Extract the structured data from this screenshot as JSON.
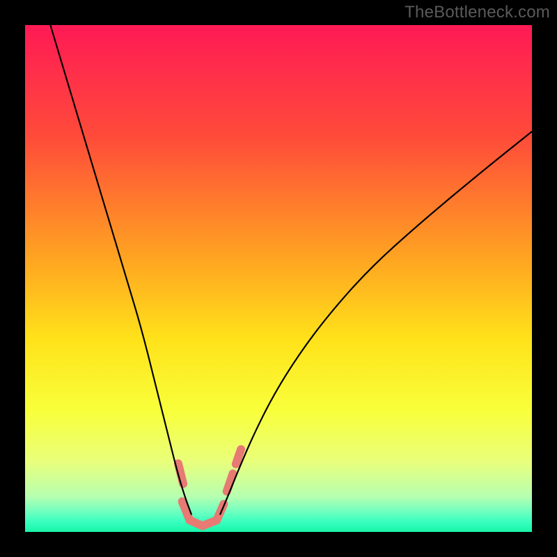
{
  "watermark": "TheBottleneck.com",
  "chart_data": {
    "type": "line",
    "title": "",
    "xlabel": "",
    "ylabel": "",
    "xlim": [
      0,
      100
    ],
    "ylim": [
      0,
      100
    ],
    "gradient_stops": [
      {
        "offset": 0,
        "color": "#ff1a55"
      },
      {
        "offset": 22,
        "color": "#ff4b3a"
      },
      {
        "offset": 45,
        "color": "#ffa022"
      },
      {
        "offset": 62,
        "color": "#ffe21a"
      },
      {
        "offset": 76,
        "color": "#f8ff3a"
      },
      {
        "offset": 86,
        "color": "#eaff7a"
      },
      {
        "offset": 93,
        "color": "#b7ffb0"
      },
      {
        "offset": 96,
        "color": "#6fffc0"
      },
      {
        "offset": 98,
        "color": "#38ffbf"
      },
      {
        "offset": 100,
        "color": "#18f5a8"
      }
    ],
    "series": [
      {
        "name": "left-arm",
        "x": [
          5,
          8,
          11,
          14,
          17,
          20,
          23,
          26,
          28,
          30,
          31.5,
          32.8
        ],
        "y": [
          100,
          90,
          80,
          70,
          60,
          50,
          40,
          28,
          20,
          12,
          7,
          3.5
        ]
      },
      {
        "name": "right-arm",
        "x": [
          38.5,
          40,
          42,
          45,
          49,
          54,
          60,
          68,
          78,
          90,
          100
        ],
        "y": [
          3.5,
          7,
          12,
          19,
          27,
          35,
          43,
          52,
          61,
          71,
          79
        ]
      }
    ],
    "highlight_band": {
      "color": "#e77a73",
      "width": 12,
      "segments": [
        [
          [
            30.2,
            13.5
          ],
          [
            31.2,
            9.5
          ]
        ],
        [
          [
            31.0,
            6.0
          ],
          [
            32.5,
            2.3
          ],
          [
            35.0,
            1.2
          ],
          [
            37.8,
            2.3
          ],
          [
            39.2,
            5.5
          ]
        ],
        [
          [
            39.8,
            8.0
          ],
          [
            41.0,
            11.5
          ]
        ],
        [
          [
            41.6,
            13.4
          ],
          [
            42.6,
            16.3
          ]
        ]
      ]
    }
  }
}
